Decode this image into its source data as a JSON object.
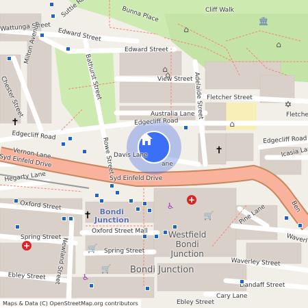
{
  "map": {
    "streets": {
      "suttie_road": "Suttie Road",
      "bunna_place": "Bunna Place",
      "cliff_walk": "Cliff Walk",
      "wattunga_street": "Wattunga Street",
      "edward_street_w": "Edward Street",
      "edward_street_e": "Edward Street",
      "milton_avenue": "Milton Avenue",
      "bathurst_street": "Bathurst Street",
      "view_street": "View Street",
      "chester_street": "Chester Street",
      "adelaide_street": "Adelaide Street",
      "fletcher_street": "Fletcher Street",
      "fletcher_street_e": "Fletcher",
      "australia_lane": "Australia Lane",
      "edgecliff_road_w": "Edgecliff Road",
      "edgecliff_road_c": "Edgecliff Road",
      "edgecliff_road_e": "Edgecliff Road",
      "vernon_lane": "Vernon Lane",
      "rowe_street": "Rowe Street",
      "davis_lane": "Davis Lane",
      "lane_partial": "ane",
      "icasia_lane": "Icasia Lane",
      "syd_einfeld_drive_w": "Syd Einfeld Drive",
      "syd_einfeld_drive_c": "Syd Einfeld Drive",
      "hegarty_lane": "Hegarty Lane",
      "oxford_street_w": "Oxford Street",
      "ben_partial": "Ben",
      "pine_lane": "Pine Lane",
      "waverley_partial": "Waverl",
      "oxford_street_mall": "Oxford Street Mall",
      "spring_street_w": "Spring Street",
      "spring_street_c": "Spring Street",
      "newland_street": "Newland Street",
      "waverley_street": "Waverley Street",
      "llandaff_street": "Llandaff Street",
      "ebley_street_w": "Ebley Street",
      "ebley_street_s": "Ebley Street",
      "cary_lane": "Cary Lane",
      "ion_partial": "ion"
    },
    "places": {
      "bondi_junction_station": "Bondi\nJunction",
      "westfield": "Westfield\nBondi\nJunction",
      "bondi_junction_suburb": "Bondi Junction"
    },
    "attribution": "Maps & Data (C) OpenStreetMap.org contributors",
    "colors": {
      "background": "#f2efe9",
      "park": "#cdebb0",
      "building": "#d9d0c9",
      "motorway": "#f9b29c",
      "motorway_casing": "#c8875b",
      "road": "#ffffff",
      "path": "#fa8072",
      "location": "#3b6ff5"
    },
    "icons": {
      "location_marker": "home-icon",
      "church": "christian-cross-icon",
      "synagogue": "star-of-david-icon",
      "hospital": "hospital-cross-icon",
      "shop": "shopping-bag-icon",
      "shelter": "shelter-icon",
      "bus_stop": "bus-stop-icon"
    }
  }
}
